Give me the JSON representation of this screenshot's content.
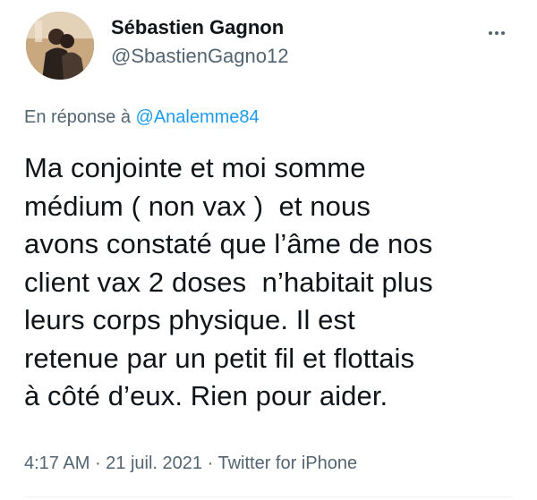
{
  "author": {
    "name": "Sébastien Gagnon",
    "handle": "@SbastienGagno12"
  },
  "reply": {
    "prefix": "En réponse à ",
    "target": "@Analemme84"
  },
  "tweet": {
    "text": "Ma conjointe et moi somme\nmédium ( non vax )  et nous\navons constaté que l’âme de nos\nclient vax 2 doses  n’habitait plus\nleurs corps physique. Il est\nretenue par un petit fil et flottais\nà côté d’eux. Rien pour aider."
  },
  "meta": {
    "time": "4:17 AM",
    "sep1": " · ",
    "date": "21 juil. 2021",
    "sep2": " · ",
    "source": "Twitter for iPhone"
  },
  "icons": {
    "more": "more-horizontal-icon"
  },
  "colors": {
    "text": "#0f1419",
    "secondary": "#536471",
    "link": "#1d9bf0"
  }
}
